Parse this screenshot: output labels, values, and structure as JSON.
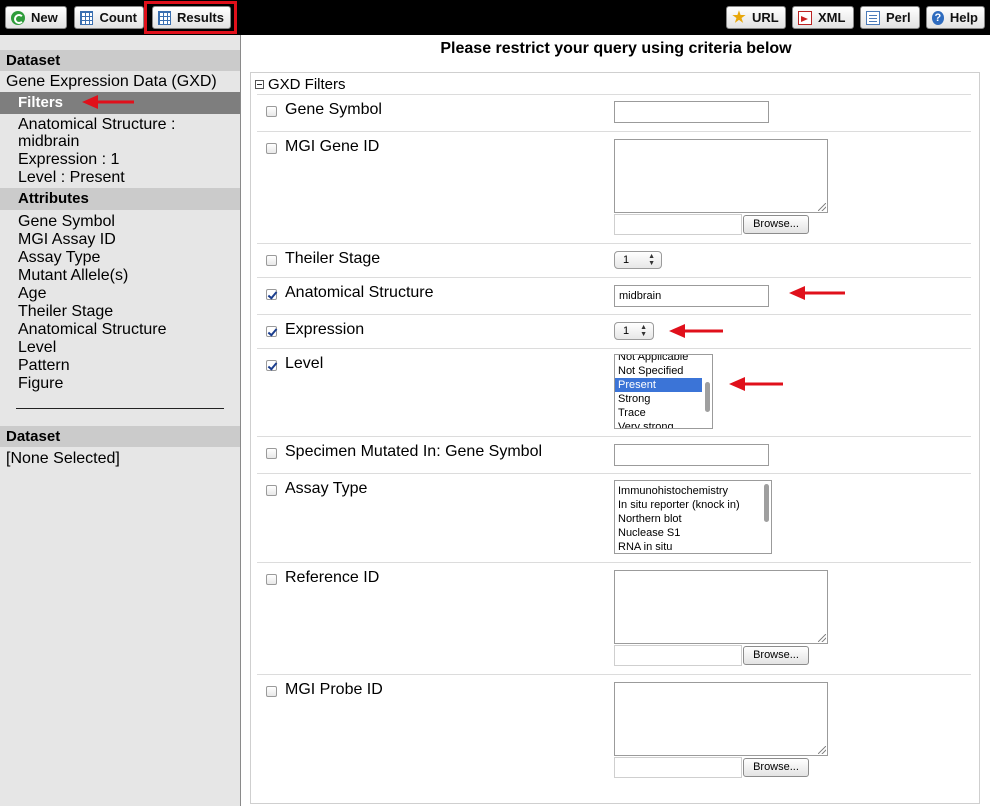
{
  "toolbar": {
    "new_label": "New",
    "count_label": "Count",
    "results_label": "Results",
    "url_label": "URL",
    "xml_label": "XML",
    "perl_label": "Perl",
    "help_label": "Help",
    "help_glyph": "?",
    "url_glyph": "★"
  },
  "sidebar": {
    "dataset_header": "Dataset",
    "dataset_name": "Gene Expression Data (GXD)",
    "filters_label": "Filters",
    "filter_summary": [
      "Anatomical Structure :",
      "midbrain",
      "Expression : 1",
      "Level : Present"
    ],
    "attributes_label": "Attributes",
    "attributes": [
      "Gene Symbol",
      "MGI Assay ID",
      "Assay Type",
      "Mutant Allele(s)",
      "Age",
      "Theiler Stage",
      "Anatomical Structure",
      "Level",
      "Pattern",
      "Figure"
    ],
    "dataset2_header": "Dataset",
    "dataset2_value": "[None Selected]"
  },
  "main": {
    "title": "Please restrict your query using criteria below",
    "panel_title": "GXD Filters",
    "browse_label": "Browse...",
    "filters": {
      "gene_symbol": {
        "label": "Gene Symbol",
        "checked": false,
        "value": ""
      },
      "mgi_gene_id": {
        "label": "MGI Gene ID",
        "checked": false
      },
      "theiler_stage": {
        "label": "Theiler Stage",
        "checked": false,
        "value": "1"
      },
      "anatomical_structure": {
        "label": "Anatomical Structure",
        "checked": true,
        "value": "midbrain"
      },
      "expression": {
        "label": "Expression",
        "checked": true,
        "value": "1"
      },
      "level": {
        "label": "Level",
        "checked": true,
        "options": [
          "Not Applicable",
          "Not Specified",
          "Present",
          "Strong",
          "Trace",
          "Very strong"
        ],
        "selected": "Present"
      },
      "specimen_mutated": {
        "label": "Specimen Mutated In: Gene Symbol",
        "checked": false,
        "value": ""
      },
      "assay_type": {
        "label": "Assay Type",
        "checked": false,
        "options": [
          "Immunohistochemistry",
          "In situ reporter (knock in)",
          "Northern blot",
          "Nuclease S1",
          "RNA in situ"
        ]
      },
      "reference_id": {
        "label": "Reference ID",
        "checked": false
      },
      "mgi_probe_id": {
        "label": "MGI Probe ID",
        "checked": false
      }
    }
  },
  "colors": {
    "annotation_red": "#e0101b",
    "selected_option": "#3b74d7",
    "sidebar_bg": "#e6e6e6",
    "filters_active_bg": "#7e7e7e"
  }
}
